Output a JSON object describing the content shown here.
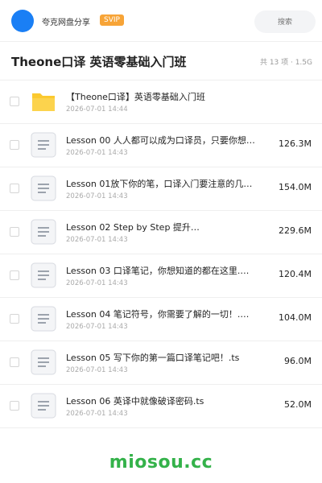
{
  "header": {
    "brand": "夸克网盘分享",
    "badge": "SVIP",
    "search_placeholder": "搜索"
  },
  "folder": {
    "title": "Theone口译 英语零基础入门班",
    "meta": "共 13 项 · 1.5G"
  },
  "files": [
    {
      "type": "folder",
      "name": "【Theone口译】英语零基础入门班",
      "date": "2026-07-01 14:44",
      "size": ""
    },
    {
      "type": "file",
      "name": "Lesson 00 人人都可以成为口译员，只要你想…",
      "date": "2026-07-01 14:43",
      "size": "126.3M"
    },
    {
      "type": "file",
      "name": "Lesson 01放下你的笔，口译入门要注意的几个…",
      "date": "2026-07-01 14:43",
      "size": "154.0M"
    },
    {
      "type": "file",
      "name": "Lesson 02 Step by Step 提升…",
      "date": "2026-07-01 14:43",
      "size": "229.6M"
    },
    {
      "type": "file",
      "name": "Lesson 03 口译笔记，你想知道的都在这里.…",
      "date": "2026-07-01 14:43",
      "size": "120.4M"
    },
    {
      "type": "file",
      "name": "Lesson 04 笔记符号，你需要了解的一切！.…",
      "date": "2026-07-01 14:43",
      "size": "104.0M"
    },
    {
      "type": "file",
      "name": "Lesson 05 写下你的第一篇口译笔记吧！.ts",
      "date": "2026-07-01 14:43",
      "size": "96.0M"
    },
    {
      "type": "file",
      "name": "Lesson 06 英译中就像破译密码.ts",
      "date": "2026-07-01 14:43",
      "size": "52.0M"
    }
  ],
  "watermark": "miosou.cc",
  "colors": {
    "accent": "#1a7ff5",
    "badge": "#f7a437",
    "folder": "#fbc92f",
    "watermark": "#34b24a"
  }
}
